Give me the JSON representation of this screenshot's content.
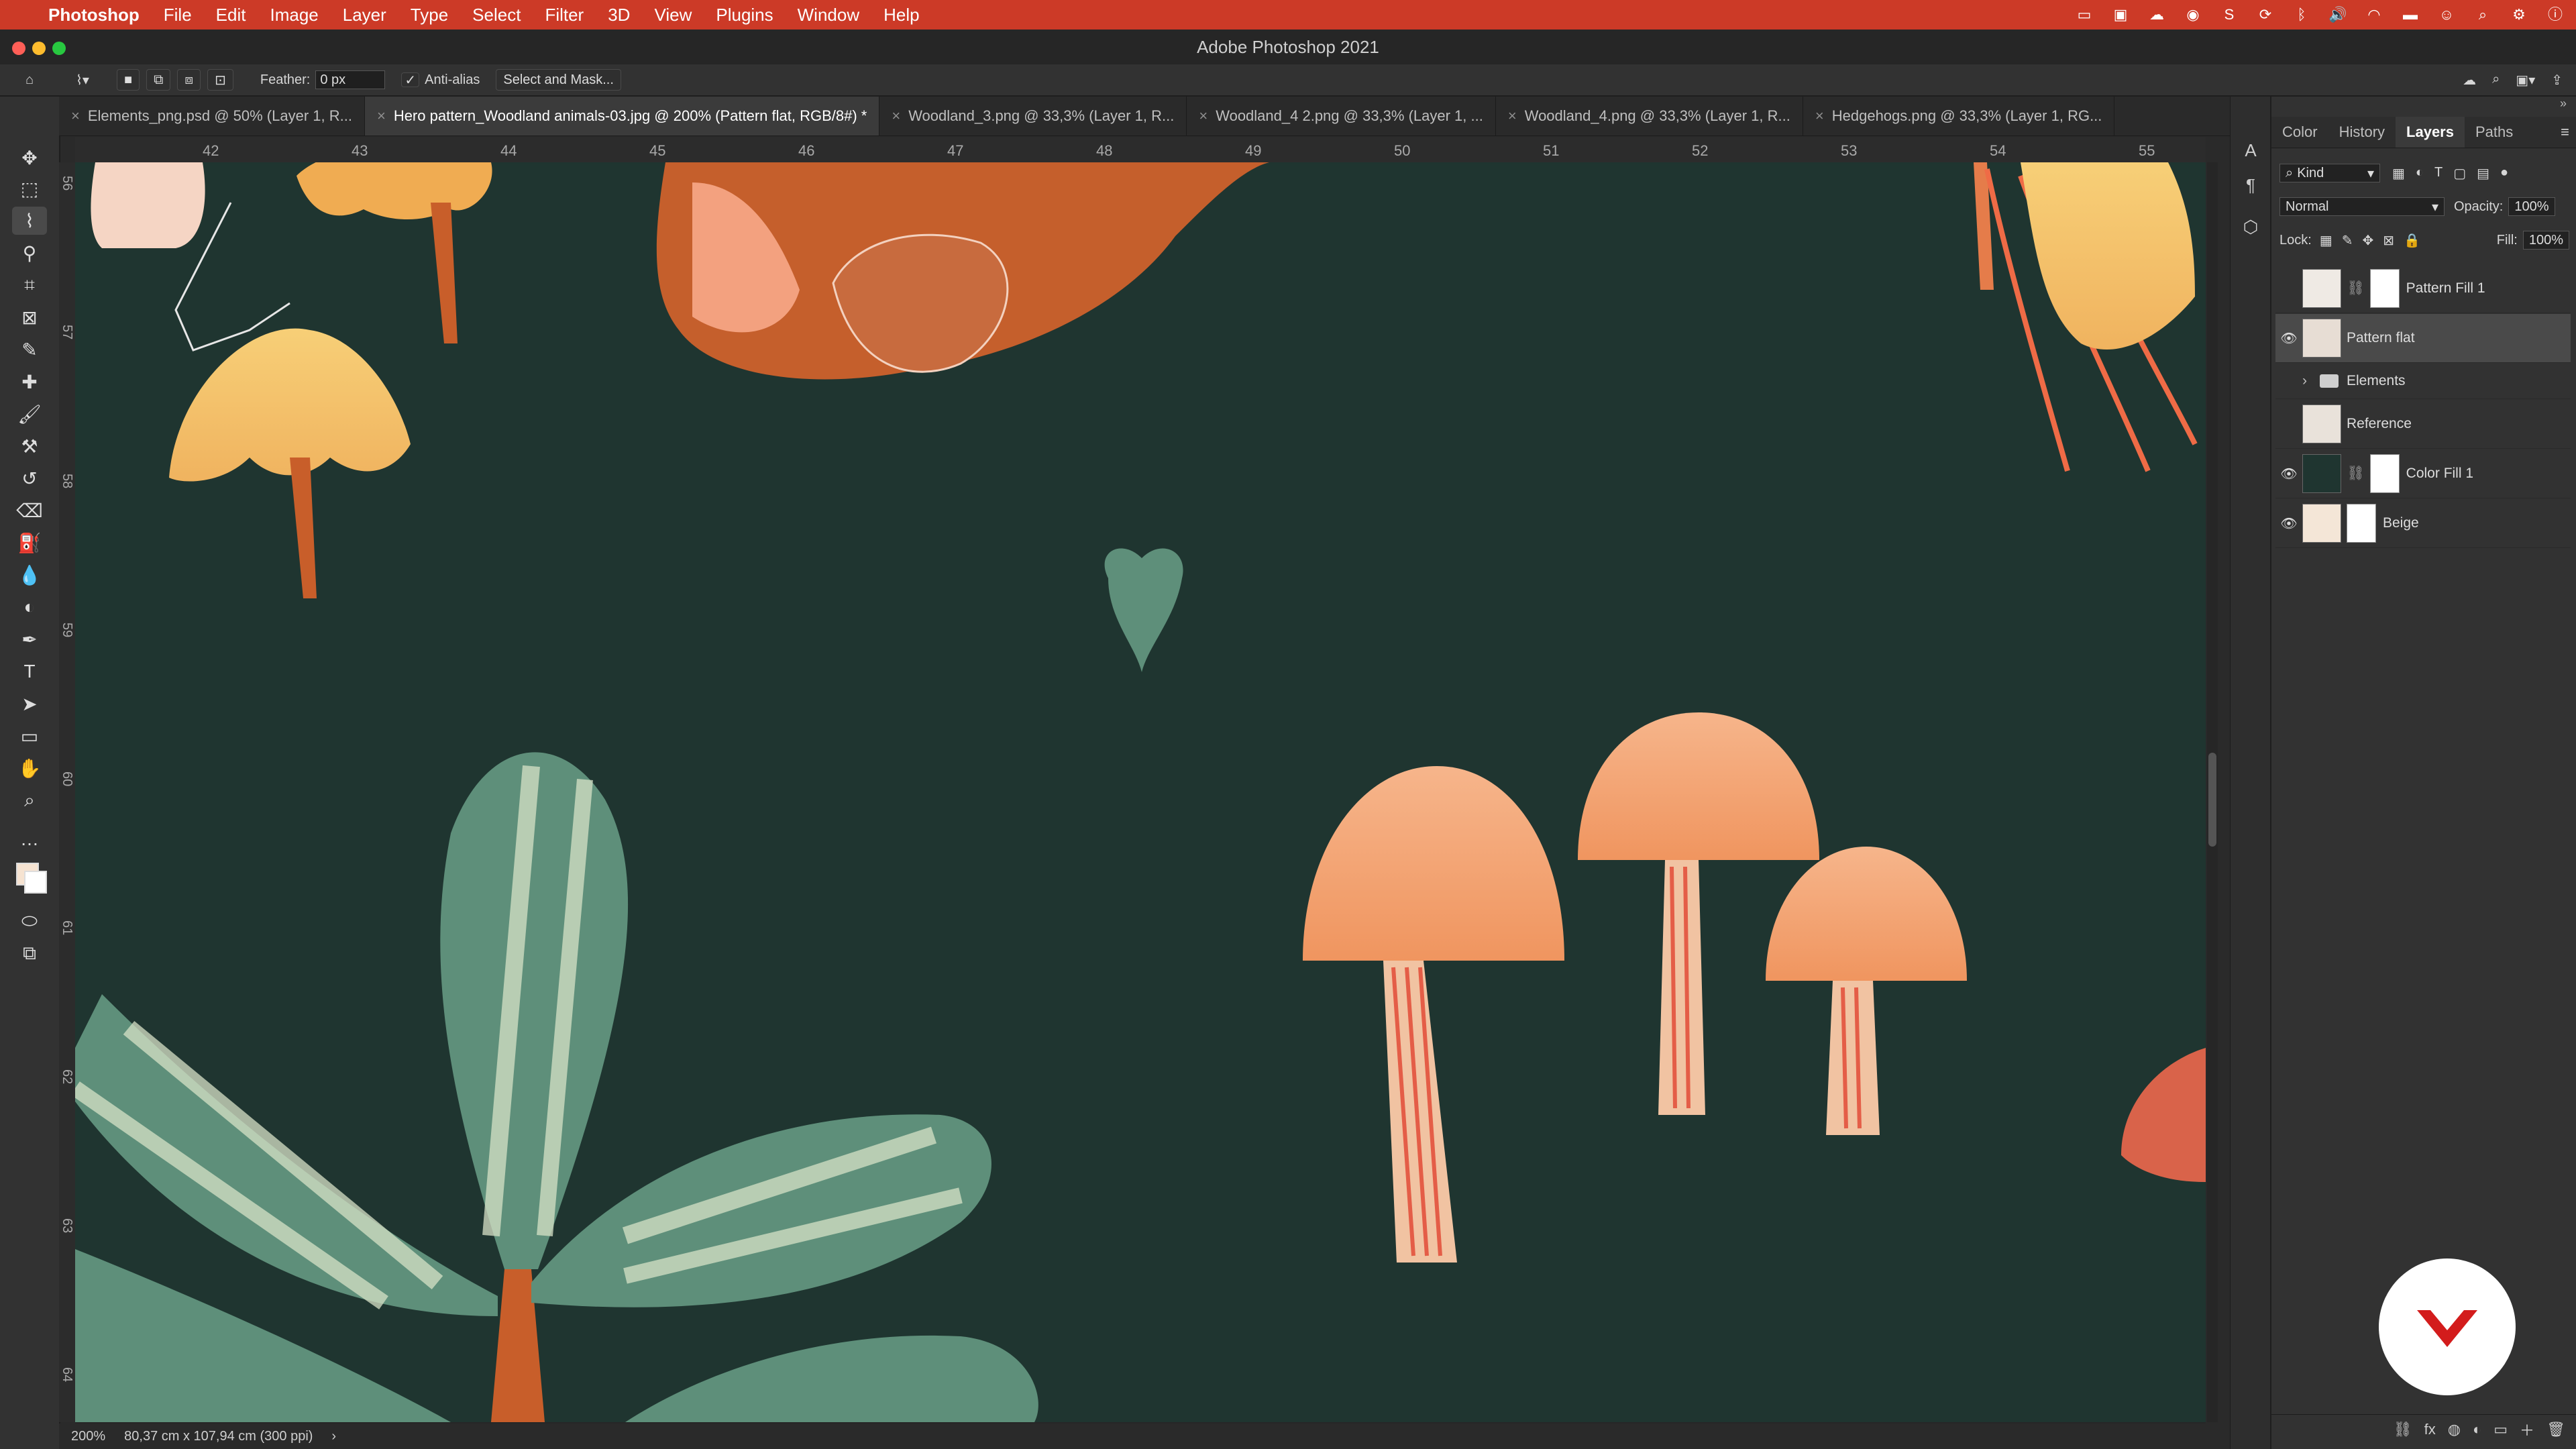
{
  "menubar": {
    "apple_glyph": "",
    "app_name": "Photoshop",
    "items": [
      "File",
      "Edit",
      "Image",
      "Layer",
      "Type",
      "Select",
      "Filter",
      "3D",
      "View",
      "Plugins",
      "Window",
      "Help"
    ]
  },
  "window": {
    "title": "Adobe Photoshop 2021"
  },
  "options": {
    "feather_label": "Feather:",
    "feather_value": "0 px",
    "antialias_label": "Anti-alias",
    "select_and_mask_label": "Select and Mask..."
  },
  "tabs": [
    {
      "label": "Elements_png.psd @ 50% (Layer 1, R..."
    },
    {
      "label": "Hero pattern_Woodland animals-03.jpg @ 200% (Pattern flat, RGB/8#) *"
    },
    {
      "label": "Woodland_3.png @ 33,3% (Layer 1, R..."
    },
    {
      "label": "Woodland_4 2.png @ 33,3% (Layer 1, ..."
    },
    {
      "label": "Woodland_4.png @ 33,3% (Layer 1, R..."
    },
    {
      "label": "Hedgehogs.png @ 33,3% (Layer 1, RG..."
    }
  ],
  "ruler_h": [
    "42",
    "43",
    "44",
    "45",
    "46",
    "47",
    "48",
    "49",
    "50",
    "51",
    "52",
    "53",
    "54",
    "55"
  ],
  "ruler_v": [
    "56",
    "57",
    "58",
    "59",
    "60",
    "61",
    "62",
    "63",
    "64"
  ],
  "status": {
    "zoom": "200%",
    "doc_info": "80,37 cm x 107,94 cm (300 ppi)",
    "chevron": "›"
  },
  "panel": {
    "tabs": [
      "Color",
      "History",
      "Layers",
      "Paths"
    ],
    "kind_label": "Kind",
    "blend_mode": "Normal",
    "opacity_label": "Opacity:",
    "opacity_value": "100%",
    "lock_label": "Lock:",
    "fill_label": "Fill:",
    "fill_value": "100%",
    "layers": [
      {
        "name": "Pattern Fill 1",
        "visible": false
      },
      {
        "name": "Pattern flat",
        "visible": true
      },
      {
        "name": "Elements",
        "visible": false
      },
      {
        "name": "Reference",
        "visible": false
      },
      {
        "name": "Color Fill 1",
        "visible": true
      },
      {
        "name": "Beige",
        "visible": true
      }
    ]
  },
  "colors": {
    "menubar": "#cc3a27",
    "canvas": "#1f3530",
    "mushroom_cap": "#f3a474",
    "mushroom_stem": "#f1c3a2",
    "leaf_green": "#5e8f7a",
    "leaf_light": "#d7e2c7"
  }
}
